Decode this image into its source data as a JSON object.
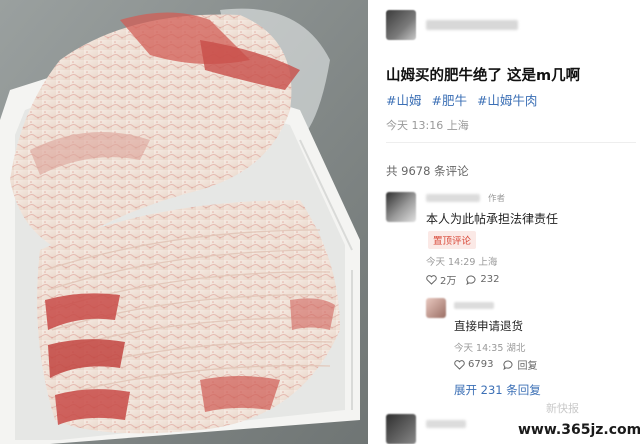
{
  "photo": {
    "subject": "fatty-beef-slices-in-tray",
    "colors": {
      "background": "#8a8f8e",
      "tray": "#f4f4f2",
      "fat": "#f1e4da",
      "meat": "#c8524d"
    }
  },
  "post": {
    "title": "山姆买的肥牛绝了 这是m几啊",
    "tags": [
      "#山姆",
      "#肥牛",
      "#山姆牛肉"
    ],
    "time": "今天 13:16 上海"
  },
  "comments_header": {
    "count_text": "共 9678 条评论"
  },
  "comments": [
    {
      "author_badge": "作者",
      "text": "本人为此帖承担法律责任",
      "pin_label": "置顶评论",
      "meta": "今天 14:29 上海",
      "likes": "2万",
      "replies": "232"
    },
    {
      "text": "直接申请退货",
      "meta": "今天 14:35 湖北",
      "likes": "6793",
      "reply_label": "回复"
    }
  ],
  "expand_label": "展开 231 条回复",
  "watermark": "新快报",
  "site_watermark": "www.365jz.com",
  "theme": {
    "link": "#3b6fb5",
    "pin": "#d94a3a",
    "muted": "#999999"
  }
}
